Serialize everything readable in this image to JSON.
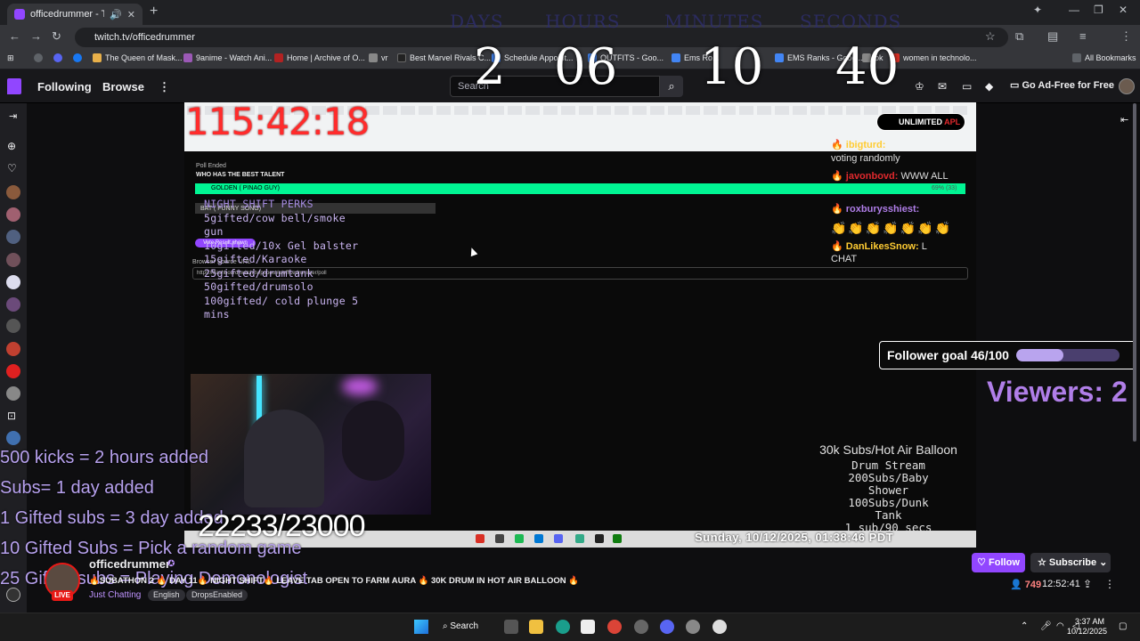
{
  "browser": {
    "tab_title": "officedrummer - Twitch",
    "url": "twitch.tv/officedrummer",
    "bookmarks": [
      {
        "label": "The Queen of Mask...",
        "color": "#e8b04a"
      },
      {
        "label": "9anime - Watch Ani...",
        "color": "#9b59b6"
      },
      {
        "label": "Home | Archive of O...",
        "color": "#b22222"
      },
      {
        "label": "vr",
        "color": "#888888"
      },
      {
        "label": "Best Marvel Rivals C...",
        "color": "#222222"
      },
      {
        "label": "Schedule Appoint...",
        "color": "#4285f4"
      },
      {
        "label": "OUTFITS - Goo...",
        "color": "#4285f4"
      },
      {
        "label": "Ems Ro...",
        "color": "#4285f4"
      },
      {
        "label": "EMS Ranks - Googl...",
        "color": "#4285f4"
      },
      {
        "label": "ok",
        "color": "#888888"
      },
      {
        "label": "women in technolo...",
        "color": "#d93025"
      }
    ],
    "all_bookmarks": "All Bookmarks"
  },
  "twitch_nav": {
    "following": "Following",
    "browse": "Browse",
    "more": "⋮",
    "search_placeholder": "Search",
    "ad_free": "Go Ad-Free for Free"
  },
  "countdown": {
    "labels": [
      "DAYS",
      "HOURS",
      "MINUTES",
      "SECONDS"
    ],
    "values": [
      "2",
      "06",
      "10",
      "40"
    ]
  },
  "stream": {
    "timer": "115:42:18",
    "unlimited_badge": "UNLIMITED",
    "poll_status": "Poll Ended",
    "poll_question": "WHO HAS THE BEST TALENT",
    "poll_option1": "GOLDEN ( PINAO GUY)",
    "poll_option1_pct": "69% (33)",
    "poll_option2": "BAT ( FUNNY SONG)",
    "poll_button": "Vote Result shown",
    "poll_url": "https://dashboard.twitch.tv/popout/u/officedrummer/poll",
    "poll_url_label": "Browser Source URL",
    "perks": [
      "NIGHT SHIFT PERKS",
      "5gifted/cow bell/smoke",
      "gun",
      "10gifted/10x Gel balster",
      "15gifted/Karaoke",
      "25gifted/drumtank",
      "50gifted/drumsolo",
      "100gifted/ cold plunge 5",
      "mins"
    ],
    "chat": [
      {
        "name": "ibigturd:",
        "msg": "",
        "color": "#ffcc33"
      },
      {
        "name": "",
        "msg": "voting randomly",
        "color": "#dddddd"
      },
      {
        "name": "javonbovd:",
        "msg": "WWW ALL",
        "color": "#e0292d"
      },
      {
        "name": "roxburysshiest:",
        "msg": "",
        "color": "#b07ee8"
      },
      {
        "name": "DanLikesSnow:",
        "msg": "L",
        "color": "#ffcc33"
      },
      {
        "name": "",
        "msg": "CHAT",
        "color": "#dddddd"
      }
    ],
    "emotes": "👏👏👏👏👏👏👏",
    "follower_goal_label": "Follower goal 46/100",
    "follower_goal_fraction": 0.46,
    "viewers_overlay": "Viewers: 2",
    "sub_count": "22233/23000",
    "rules": [
      "500 kicks = 2 hours added",
      "Subs= 1 day added",
      "1 Gifted subs = 3 day added",
      "10 Gifted Subs = Pick a random game",
      "25 Gifted subs = Playing Demonologist"
    ],
    "sub_goals": [
      "30k Subs/Hot Air Balloon",
      "Drum Stream",
      "200Subs/Baby",
      "Shower",
      "100Subs/Dunk",
      "Tank",
      "1 sub/90 secs"
    ],
    "inner_date": "Sunday, 10/12/2025, 01:38:46 PDT"
  },
  "channel": {
    "name": "officedrummer",
    "live": "LIVE",
    "title": "🔥SUBATHON 2 🔥 DAY 11🔥 NIGHT SHIFT🔥 LEAVE TAB OPEN TO FARM AURA 🔥 30K DRUM IN HOT AIR BALLOON 🔥",
    "category": "Just Chatting",
    "tags": [
      "English",
      "DropsEnabled"
    ],
    "follow": "Follow",
    "subscribe": "Subscribe",
    "viewer_count": "749",
    "uptime": "12:52:41"
  },
  "windows": {
    "search": "Search",
    "time": "3:37 AM",
    "date": "10/12/2025"
  }
}
